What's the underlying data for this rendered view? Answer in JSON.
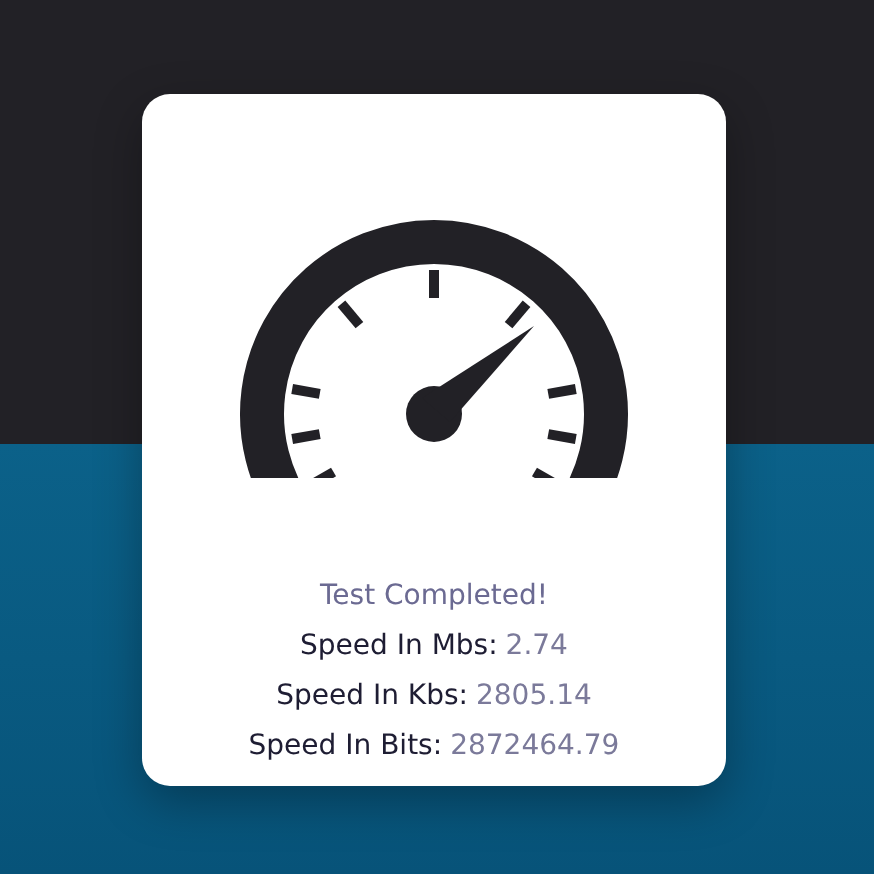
{
  "status": "Test Completed!",
  "results": [
    {
      "label": "Speed In Mbs:",
      "value": "2.74"
    },
    {
      "label": "Speed In Kbs:",
      "value": "2805.14"
    },
    {
      "label": "Speed In Bits:",
      "value": "2872464.79"
    }
  ]
}
